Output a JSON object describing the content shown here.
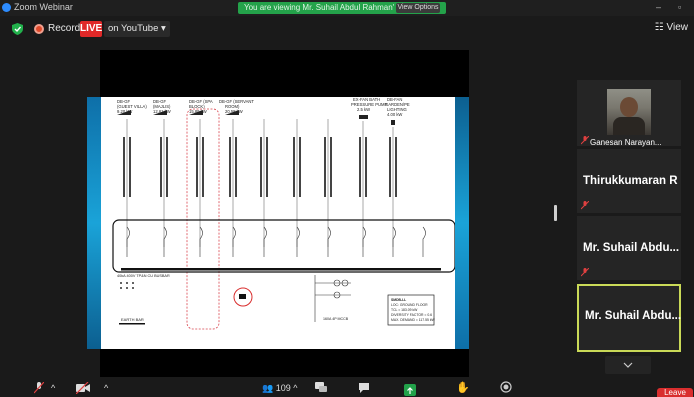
{
  "window": {
    "title": "Zoom Webinar"
  },
  "share_banner": {
    "text": "You are viewing Mr. Suhail Abdul Rahman's screen",
    "button": "View Options"
  },
  "recording": {
    "label": "Recording",
    "live": "LIVE",
    "stream": "on YouTube ▾"
  },
  "view_button": "View",
  "drawing": {
    "feeders": [
      {
        "lines": [
          "DB-GF",
          "(GUEST VILLA)",
          "9.20 kW"
        ]
      },
      {
        "lines": [
          "DB-GF",
          "(MAJLIS)",
          "12.61 kW"
        ]
      },
      {
        "lines": [
          "DB-GF (SPA",
          "BLOCK)",
          "15.89 kW"
        ]
      },
      {
        "lines": [
          "DB-GF (SERVANT",
          "ROOM)",
          "20.58 kW"
        ]
      },
      {
        "lines": [
          "EX-FAN BATH",
          "PRESSURE PUMP",
          "2.5 kW"
        ]
      },
      {
        "lines": [
          "DB-FAN",
          "GARDEN/PE",
          "LIGHTING",
          "4.00 kW"
        ]
      }
    ],
    "bus_note": "40kA 400V TP&N CU BUSBAR",
    "earth_label": "EARTH BAR",
    "breaker_label": "160A 4P MCCB",
    "notes": [
      "SMDB-LL",
      "LOC: GROUND FLOOR",
      "TCL = 183.09 kW",
      "DIVERSITY FACTOR = 0.6",
      "MAX. DEMAND = 117.55 kW"
    ]
  },
  "participants": [
    {
      "name": "Ganesan Narayan...",
      "video": true
    },
    {
      "name": "Thirukkumaran R"
    },
    {
      "name": "Mr. Suhail Abdu..."
    },
    {
      "name": "Mr. Suhail Abdu...",
      "active": true
    }
  ],
  "toolbar": {
    "participant_count": "109",
    "leave": "Leave"
  },
  "colors": {
    "live": "#e02828",
    "active_border": "#c9d957",
    "share_banner": "#24a24a"
  }
}
